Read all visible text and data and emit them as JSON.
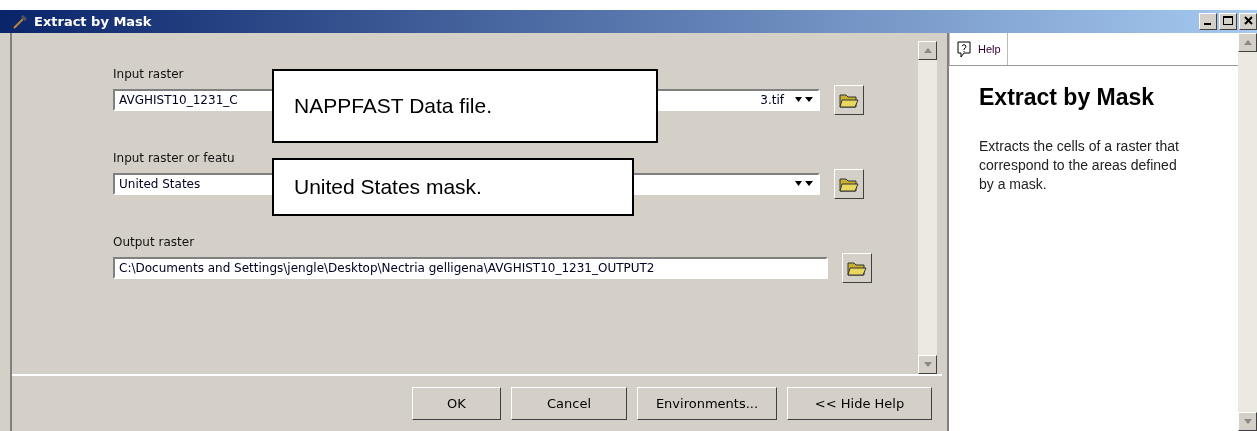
{
  "window": {
    "title": "Extract by Mask"
  },
  "params": [
    {
      "label": "Input raster",
      "value_start": "AVGHIST10_1231_C",
      "value_end": "3.tif",
      "kind": "dropdown"
    },
    {
      "label": "Input raster or featu",
      "value_start": "United States",
      "kind": "dropdown"
    },
    {
      "label": "Output raster",
      "value_start": "C:\\Documents and Settings\\jengle\\Desktop\\Nectria gelligena\\AVGHIST10_1231_OUTPUT2",
      "kind": "text"
    }
  ],
  "callouts": [
    "NAPPFAST Data file.",
    "United States mask."
  ],
  "buttons": [
    "OK",
    "Cancel",
    "Environments...",
    "<< Hide Help"
  ],
  "help": {
    "tab": "Help",
    "title": "Extract by Mask",
    "description": "Extracts the cells of a raster that correspond to the areas defined by a mask."
  }
}
